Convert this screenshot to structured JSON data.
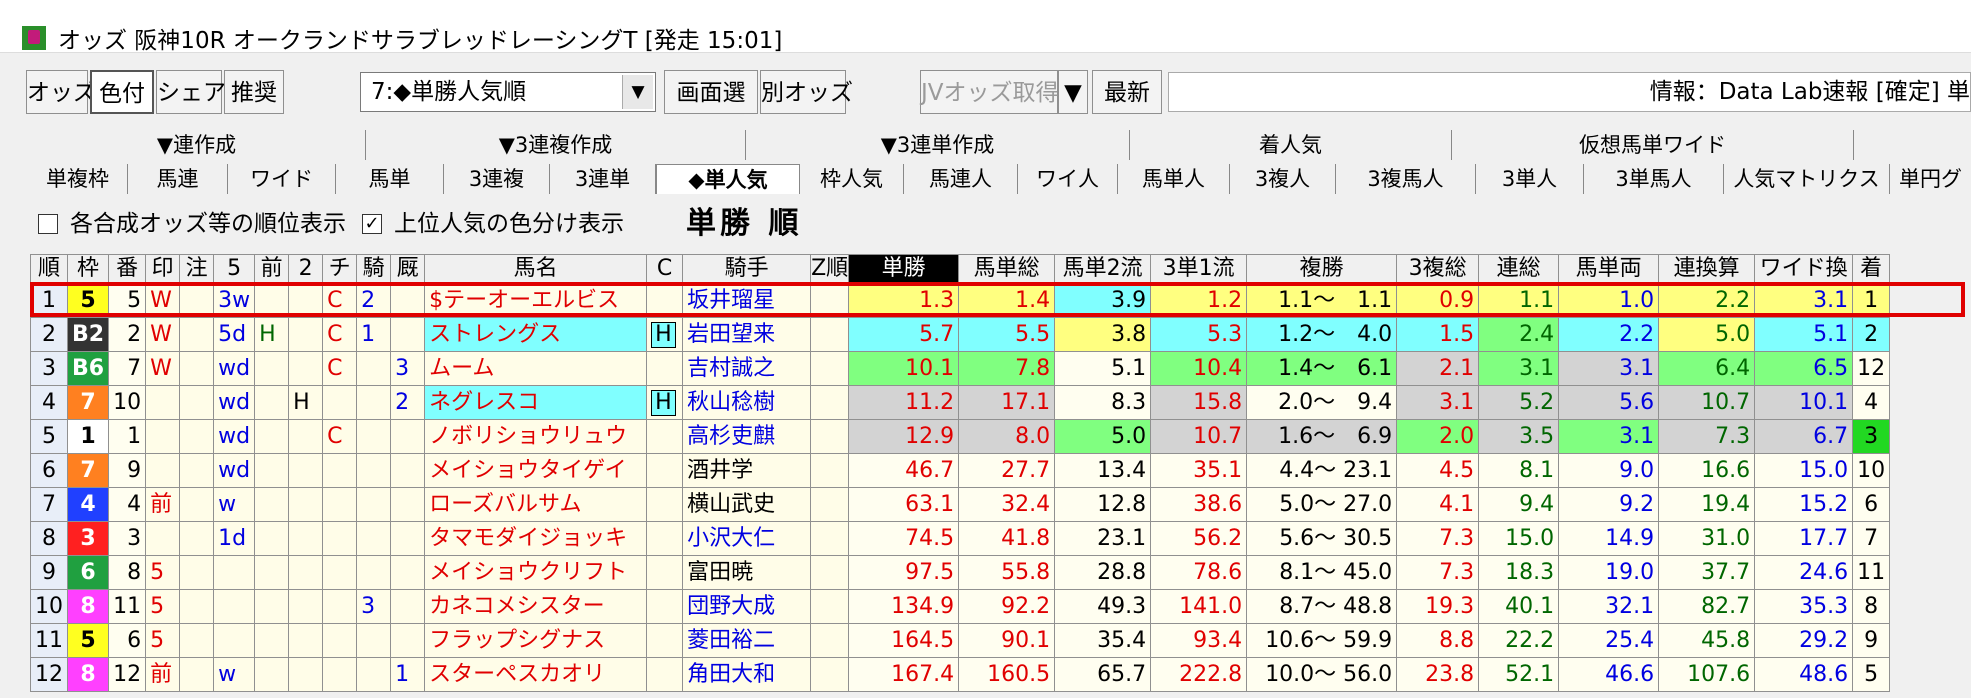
{
  "window": {
    "title": "オッズ 阪神10R オークランドサラブレッドレーシングT  [発走 15:01]"
  },
  "toolbar": {
    "buttons": [
      "オッズ",
      "色付",
      "シェア",
      "推奨"
    ],
    "combo_value": "7:◆単勝人気順",
    "buttons2": [
      "画面選",
      "別オッズ"
    ],
    "jv_button": "JVオッズ取得",
    "jv_arrow": "▼",
    "latest_button": "最新",
    "info_text": "情報：Data Lab速報 [確定] 単"
  },
  "tabs_top": [
    "▼連作成",
    "▼3連複作成",
    "▼3連単作成",
    "着人気",
    "仮想馬単ワイド",
    ""
  ],
  "tabs_bottom": [
    "単複枠",
    "馬連",
    "ワイド",
    "馬単",
    "3連複",
    "3連単",
    "◆単人気",
    "枠人気",
    "馬連人",
    "ワイ人",
    "馬単人",
    "3複人",
    "3複馬人",
    "3単人",
    "3単馬人",
    "人気マトリクス",
    "単円グ"
  ],
  "options": {
    "opt1_label": "各合成オッズ等の順位表示",
    "opt1_checked": "",
    "opt2_label": "上位人気の色分け表示",
    "opt2_checked": "✓",
    "sort_label": "単勝 順"
  },
  "table": {
    "headers": [
      "順",
      "枠",
      "番",
      "印",
      "注",
      "5",
      "前",
      "2",
      "チ",
      "騎",
      "厩",
      "馬名",
      "C",
      "騎手",
      "Z順",
      "単勝",
      "馬単総",
      "馬単2流",
      "3単1流",
      "複勝",
      "3複総",
      "連総",
      "馬単両",
      "連換算",
      "ワイド換",
      "着"
    ],
    "rows": [
      {
        "rank": "1",
        "waku": "5",
        "uma": "5",
        "mark": "W",
        "note": "",
        "f5": "3w",
        "mae": "",
        "f2": "",
        "chi": "C",
        "ki": "2",
        "kyu": "",
        "name": "$テーオーエルビス",
        "c": "",
        "jockey": "坂井瑠星",
        "z": "",
        "tan": "1.3",
        "umatan": "1.4",
        "umatan2": "3.9",
        "san1": "1.2",
        "fuku": "1.1～　1.1",
        "sanfuku": "0.9",
        "ren": "1.1",
        "umaryo": "1.0",
        "renkan": "2.2",
        "wide": "3.1",
        "chaku": "1"
      },
      {
        "rank": "2",
        "waku": "B2",
        "uma": "2",
        "mark": "W",
        "note": "",
        "f5": "5d",
        "mae": "H",
        "f2": "",
        "chi": "C",
        "ki": "1",
        "kyu": "",
        "name": "ストレングス",
        "c": "H",
        "jockey": "岩田望来",
        "z": "",
        "tan": "5.7",
        "umatan": "5.5",
        "umatan2": "3.8",
        "san1": "5.3",
        "fuku": "1.2～　4.0",
        "sanfuku": "1.5",
        "ren": "2.4",
        "umaryo": "2.2",
        "renkan": "5.0",
        "wide": "5.1",
        "chaku": "2"
      },
      {
        "rank": "3",
        "waku": "B6",
        "uma": "7",
        "mark": "W",
        "note": "",
        "f5": "wd",
        "mae": "",
        "f2": "",
        "chi": "C",
        "ki": "",
        "kyu": "3",
        "name": "ムーム",
        "c": "",
        "jockey": "吉村誠之",
        "z": "",
        "tan": "10.1",
        "umatan": "7.8",
        "umatan2": "5.1",
        "san1": "10.4",
        "fuku": "1.4～　6.1",
        "sanfuku": "2.1",
        "ren": "3.1",
        "umaryo": "3.1",
        "renkan": "6.4",
        "wide": "6.5",
        "chaku": "12"
      },
      {
        "rank": "4",
        "waku": "7",
        "uma": "10",
        "mark": "",
        "note": "",
        "f5": "wd",
        "mae": "",
        "f2": "H",
        "chi": "",
        "ki": "",
        "kyu": "2",
        "name": "ネグレスコ",
        "c": "H",
        "jockey": "秋山稔樹",
        "z": "",
        "tan": "11.2",
        "umatan": "17.1",
        "umatan2": "8.3",
        "san1": "15.8",
        "fuku": "2.0～　9.4",
        "sanfuku": "3.1",
        "ren": "5.2",
        "umaryo": "5.6",
        "renkan": "10.7",
        "wide": "10.1",
        "chaku": "4"
      },
      {
        "rank": "5",
        "waku": "1",
        "uma": "1",
        "mark": "",
        "note": "",
        "f5": "wd",
        "mae": "",
        "f2": "",
        "chi": "C",
        "ki": "",
        "kyu": "",
        "name": "ノボリショウリュウ",
        "c": "",
        "jockey": "高杉吏麒",
        "z": "",
        "tan": "12.9",
        "umatan": "8.0",
        "umatan2": "5.0",
        "san1": "10.7",
        "fuku": "1.6～　6.9",
        "sanfuku": "2.0",
        "ren": "3.5",
        "umaryo": "3.1",
        "renkan": "7.3",
        "wide": "6.7",
        "chaku": "3"
      },
      {
        "rank": "6",
        "waku": "7",
        "uma": "9",
        "mark": "",
        "note": "",
        "f5": "wd",
        "mae": "",
        "f2": "",
        "chi": "",
        "ki": "",
        "kyu": "",
        "name": "メイショウタイゲイ",
        "c": "",
        "jockey": "酒井学",
        "z": "",
        "tan": "46.7",
        "umatan": "27.7",
        "umatan2": "13.4",
        "san1": "35.1",
        "fuku": "4.4～ 23.1",
        "sanfuku": "4.5",
        "ren": "8.1",
        "umaryo": "9.0",
        "renkan": "16.6",
        "wide": "15.0",
        "chaku": "10"
      },
      {
        "rank": "7",
        "waku": "4",
        "uma": "4",
        "mark": "前",
        "note": "",
        "f5": "w",
        "mae": "",
        "f2": "",
        "chi": "",
        "ki": "",
        "kyu": "",
        "name": "ローズバルサム",
        "c": "",
        "jockey": "横山武史",
        "z": "",
        "tan": "63.1",
        "umatan": "32.4",
        "umatan2": "12.8",
        "san1": "38.6",
        "fuku": "5.0～ 27.0",
        "sanfuku": "4.1",
        "ren": "9.4",
        "umaryo": "9.2",
        "renkan": "19.4",
        "wide": "15.2",
        "chaku": "6"
      },
      {
        "rank": "8",
        "waku": "3",
        "uma": "3",
        "mark": "",
        "note": "",
        "f5": "1d",
        "mae": "",
        "f2": "",
        "chi": "",
        "ki": "",
        "kyu": "",
        "name": "タマモダイジョッキ",
        "c": "",
        "jockey": "小沢大仁",
        "z": "",
        "tan": "74.5",
        "umatan": "41.8",
        "umatan2": "23.1",
        "san1": "56.2",
        "fuku": "5.6～ 30.5",
        "sanfuku": "7.3",
        "ren": "15.0",
        "umaryo": "14.9",
        "renkan": "31.0",
        "wide": "17.7",
        "chaku": "7"
      },
      {
        "rank": "9",
        "waku": "6",
        "uma": "8",
        "mark": "5",
        "note": "",
        "f5": "",
        "mae": "",
        "f2": "",
        "chi": "",
        "ki": "",
        "kyu": "",
        "name": "メイショウクリフト",
        "c": "",
        "jockey": "富田暁",
        "z": "",
        "tan": "97.5",
        "umatan": "55.8",
        "umatan2": "28.8",
        "san1": "78.6",
        "fuku": "8.1～ 45.0",
        "sanfuku": "7.3",
        "ren": "18.3",
        "umaryo": "19.0",
        "renkan": "37.7",
        "wide": "24.6",
        "chaku": "11"
      },
      {
        "rank": "10",
        "waku": "8",
        "uma": "11",
        "mark": "5",
        "note": "",
        "f5": "",
        "mae": "",
        "f2": "",
        "chi": "",
        "ki": "3",
        "kyu": "",
        "name": "カネコメシスター",
        "c": "",
        "jockey": "団野大成",
        "z": "",
        "tan": "134.9",
        "umatan": "92.2",
        "umatan2": "49.3",
        "san1": "141.0",
        "fuku": "8.7～ 48.8",
        "sanfuku": "19.3",
        "ren": "40.1",
        "umaryo": "32.1",
        "renkan": "82.7",
        "wide": "35.3",
        "chaku": "8"
      },
      {
        "rank": "11",
        "waku": "5",
        "uma": "6",
        "mark": "5",
        "note": "",
        "f5": "",
        "mae": "",
        "f2": "",
        "chi": "",
        "ki": "",
        "kyu": "",
        "name": "フラップシグナス",
        "c": "",
        "jockey": "菱田裕二",
        "z": "",
        "tan": "164.5",
        "umatan": "90.1",
        "umatan2": "35.4",
        "san1": "93.4",
        "fuku": "10.6～ 59.9",
        "sanfuku": "8.8",
        "ren": "22.2",
        "umaryo": "25.4",
        "renkan": "45.8",
        "wide": "29.2",
        "chaku": "9"
      },
      {
        "rank": "12",
        "waku": "8",
        "uma": "12",
        "mark": "前",
        "note": "",
        "f5": "w",
        "mae": "",
        "f2": "",
        "chi": "",
        "ki": "",
        "kyu": "1",
        "name": "スターペスカオリ",
        "c": "",
        "jockey": "角田大和",
        "z": "",
        "tan": "167.4",
        "umatan": "160.5",
        "umatan2": "65.7",
        "san1": "222.8",
        "fuku": "10.0～ 56.0",
        "sanfuku": "23.8",
        "ren": "52.1",
        "umaryo": "46.6",
        "renkan": "107.6",
        "wide": "48.6",
        "chaku": "5"
      }
    ]
  },
  "colors": {
    "selection": "#e00000",
    "yellow": "#ffff80",
    "cyan": "#80ffff",
    "green": "#80ff80",
    "gray": "#d3d3d3"
  }
}
